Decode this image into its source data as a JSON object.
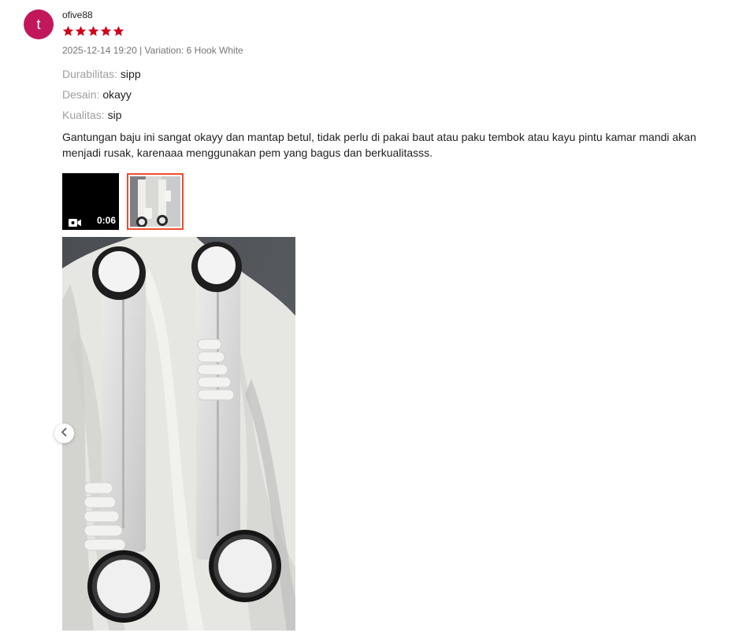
{
  "review": {
    "avatar_letter": "t",
    "username": "ofive88",
    "rating": 5,
    "star_color": "#d0011b",
    "date_variation": "2025-12-14 19:20 | Variation: 6 Hook White",
    "attributes": [
      {
        "key": "Durabilitas:",
        "value": "sipp"
      },
      {
        "key": "Desain:",
        "value": "okayy"
      },
      {
        "key": "Kualitas:",
        "value": "sip"
      }
    ],
    "comment": "Gantungan baju ini sangat okayy dan mantap betul, tidak perlu di pakai baut atau paku tembok atau kayu pintu kamar mandi akan menjadi rusak, karenaaa menggunakan pem yang bagus dan berkualitasss.",
    "media": {
      "video_duration": "0:06",
      "video_icon": "video-camera-icon",
      "photo_icon": "photo-thumbnail",
      "selected_border_color": "#ee4d2d",
      "nav_prev_icon": "chevron-left-icon"
    }
  }
}
